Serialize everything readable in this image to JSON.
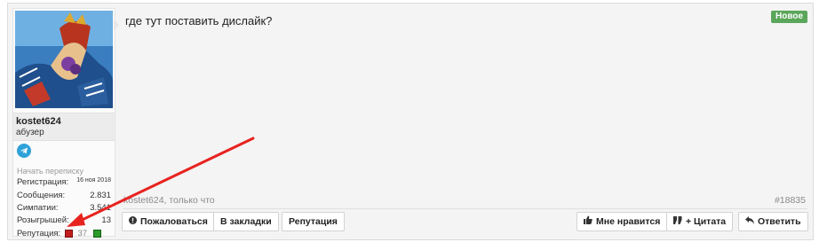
{
  "post": {
    "message": "где тут поставить дислайк?",
    "badge": "Новое",
    "footer_author": "kostet624, только что",
    "post_number": "#18835"
  },
  "author": {
    "username": "kostet624",
    "title": "абузер",
    "start_pm": "Начать переписку",
    "stats": [
      {
        "label": "Регистрация:",
        "value": "16 ноя 2018"
      },
      {
        "label": "Сообщения:",
        "value": "2.831"
      },
      {
        "label": "Симпатии:",
        "value": "3.541"
      },
      {
        "label": "Розыгрышей:",
        "value": "13"
      }
    ],
    "reputation_label": "Репутация:",
    "reputation_value": "37"
  },
  "actions_left": [
    {
      "label": "Пожаловаться",
      "icon": "alert-icon"
    },
    {
      "label": "В закладки"
    },
    {
      "label": "Репутация"
    }
  ],
  "actions_right": [
    {
      "label": "Мне нравится",
      "icon": "thumbs-up-icon"
    },
    {
      "label": "+ Цитата",
      "icon": "quote-icon"
    },
    {
      "label": "Ответить",
      "icon": "reply-icon"
    }
  ],
  "colors": {
    "badge": "#5aa65a",
    "annotation_arrow": "#e8231f",
    "telegram": "#2ea1d9"
  }
}
